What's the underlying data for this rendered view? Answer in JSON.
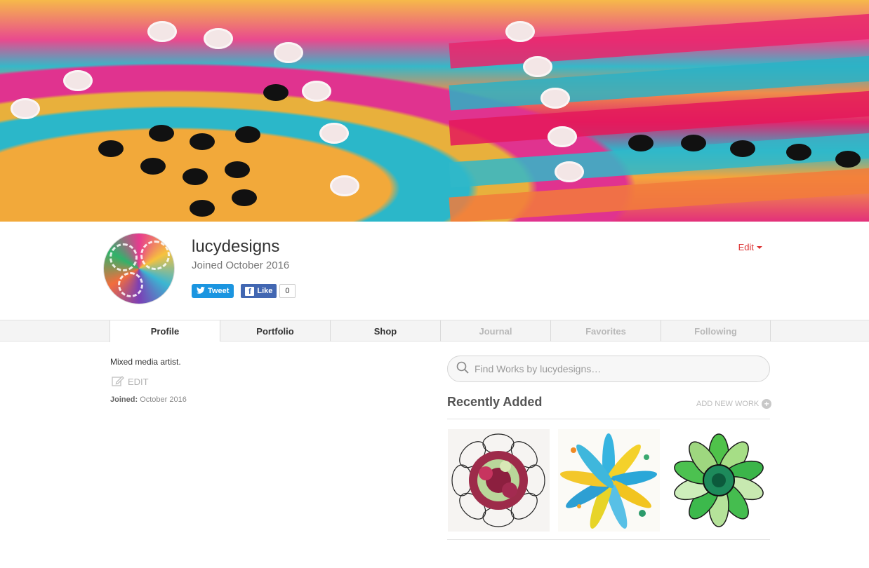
{
  "profile": {
    "username": "lucydesigns",
    "joined_text": "Joined October 2016",
    "edit_label": "Edit",
    "tweet_label": "Tweet",
    "like_label": "Like",
    "like_count": "0"
  },
  "tabs": [
    {
      "label": "Profile",
      "state": "active"
    },
    {
      "label": "Portfolio",
      "state": "normal"
    },
    {
      "label": "Shop",
      "state": "normal"
    },
    {
      "label": "Journal",
      "state": "disabled"
    },
    {
      "label": "Favorites",
      "state": "disabled"
    },
    {
      "label": "Following",
      "state": "disabled"
    }
  ],
  "about": {
    "bio": "Mixed media artist.",
    "edit_label": "EDIT",
    "joined_label": "Joined:",
    "joined_value": "October 2016"
  },
  "search": {
    "placeholder": "Find Works by lucydesigns…"
  },
  "recent": {
    "title": "Recently Added",
    "add_label": "ADD NEW WORK"
  },
  "icons": {
    "search": "search-icon",
    "edit": "pencil-edit-icon",
    "add": "plus-circle-icon",
    "twitter": "twitter-bird-icon",
    "facebook": "facebook-f-icon",
    "caret": "caret-down-icon"
  },
  "colors": {
    "accent_red": "#dd3333",
    "twitter_blue": "#1b95e0",
    "facebook_blue": "#4267b2"
  }
}
